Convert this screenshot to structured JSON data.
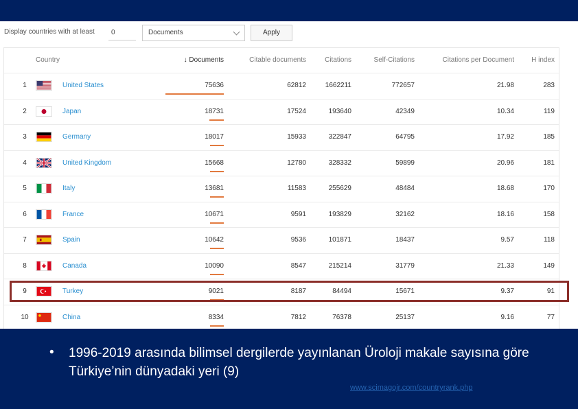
{
  "toolbar": {
    "display_label": "Display countries with at least",
    "min_value": "0",
    "select_value": "Documents",
    "apply_label": "Apply"
  },
  "table": {
    "headers": {
      "country": "Country",
      "documents": "↓ Documents",
      "citable": "Citable documents",
      "citations": "Citations",
      "self": "Self-Citations",
      "cpd": "Citations per Document",
      "h": "H index"
    },
    "rows": [
      {
        "rank": "1",
        "country": "United States",
        "flag": "us",
        "documents": "75636",
        "citable": "62812",
        "citations": "1662211",
        "self": "772657",
        "cpd": "21.98",
        "h": "283",
        "share": 1.0
      },
      {
        "rank": "2",
        "country": "Japan",
        "flag": "jp",
        "documents": "18731",
        "citable": "17524",
        "citations": "193640",
        "self": "42349",
        "cpd": "10.34",
        "h": "119",
        "share": 0.25
      },
      {
        "rank": "3",
        "country": "Germany",
        "flag": "de",
        "documents": "18017",
        "citable": "15933",
        "citations": "322847",
        "self": "64795",
        "cpd": "17.92",
        "h": "185",
        "share": 0.24
      },
      {
        "rank": "4",
        "country": "United Kingdom",
        "flag": "gb",
        "documents": "15668",
        "citable": "12780",
        "citations": "328332",
        "self": "59899",
        "cpd": "20.96",
        "h": "181",
        "share": 0.21
      },
      {
        "rank": "5",
        "country": "Italy",
        "flag": "it",
        "documents": "13681",
        "citable": "11583",
        "citations": "255629",
        "self": "48484",
        "cpd": "18.68",
        "h": "170",
        "share": 0.18
      },
      {
        "rank": "6",
        "country": "France",
        "flag": "fr",
        "documents": "10671",
        "citable": "9591",
        "citations": "193829",
        "self": "32162",
        "cpd": "18.16",
        "h": "158",
        "share": 0.14
      },
      {
        "rank": "7",
        "country": "Spain",
        "flag": "es",
        "documents": "10642",
        "citable": "9536",
        "citations": "101871",
        "self": "18437",
        "cpd": "9.57",
        "h": "118",
        "share": 0.14
      },
      {
        "rank": "8",
        "country": "Canada",
        "flag": "ca",
        "documents": "10090",
        "citable": "8547",
        "citations": "215214",
        "self": "31779",
        "cpd": "21.33",
        "h": "149",
        "share": 0.13
      },
      {
        "rank": "9",
        "country": "Turkey",
        "flag": "tr",
        "documents": "9021",
        "citable": "8187",
        "citations": "84494",
        "self": "15671",
        "cpd": "9.37",
        "h": "91",
        "share": 0.12
      },
      {
        "rank": "10",
        "country": "China",
        "flag": "cn",
        "documents": "8334",
        "citable": "7812",
        "citations": "76378",
        "self": "25137",
        "cpd": "9.16",
        "h": "77",
        "share": 0.11
      }
    ],
    "highlight_color": "#8b2e2a",
    "bar_color": "#e27a3f",
    "link_color": "#2a8fd0"
  },
  "footer": {
    "bullet": "•",
    "text": "1996-2019 arasında bilimsel dergilerde yayınlanan Üroloji makale sayısına göre Türkiye’nin dünyadaki yeri (9)",
    "link": "www.scimagojr.com/countryrank.php",
    "bg_color": "#002060"
  }
}
